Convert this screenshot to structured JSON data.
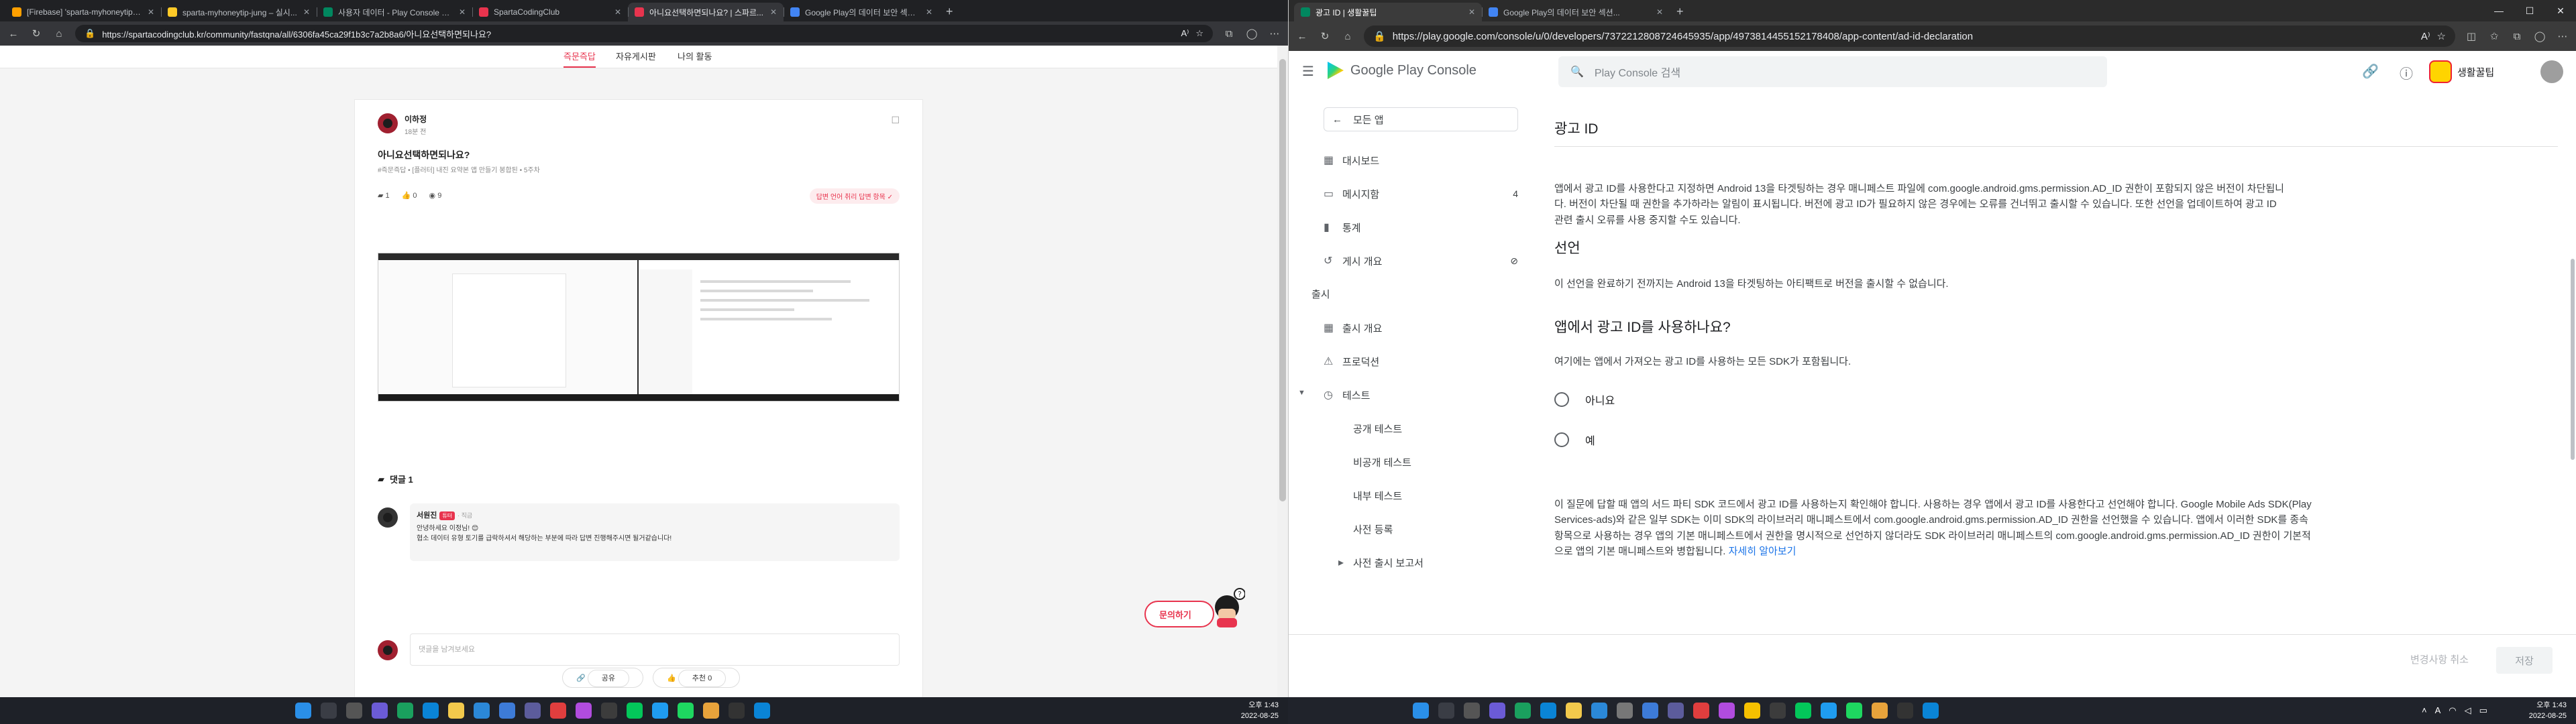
{
  "left_window": {
    "tabs": [
      {
        "label": "[Firebase] 'sparta-myhoneytip-j...",
        "fav_color": "#ffa000"
      },
      {
        "label": "sparta-myhoneytip-jung – 실시...",
        "fav_color": "#ffca28"
      },
      {
        "label": "사용자 데이터 - Play Console 고...",
        "fav_color": "#01875f"
      },
      {
        "label": "SpartaCodingClub",
        "fav_color": "#e8344e"
      },
      {
        "label": "아니요선택하면되나요? | 스파르...",
        "fav_color": "#e8344e",
        "active": true
      },
      {
        "label": "Google Play의 데이터 보안 섹션...",
        "fav_color": "#4285f4"
      }
    ],
    "url": "https://spartacodingclub.kr/community/fastqna/all/6306fa45ca29f1b3c7a2b8a6/아니요선택하면되나요?",
    "nav": {
      "active": "즉문즉답",
      "items": [
        "즉문즉답",
        "자유게시판",
        "나의 활동"
      ]
    },
    "post": {
      "author": "이하정",
      "time": "18분 전",
      "title": "아니요선택하면되나요?",
      "tags": "#즉문즉답 • [플러터] 내진 요약본 앱 만들기 봉합된 • 5주차",
      "likes_comments": "1",
      "likes": "0",
      "views": "9",
      "answer_label": "답변 언어 취리 답변 항목"
    },
    "comments": {
      "heading": "댓글 1",
      "items": [
        {
          "name": "서원진",
          "badge": "튜터",
          "time": "·  직금",
          "text_1": "안녕하세요 이정님! 😊",
          "text_2": "협소 데이터 유형 토기를 급락하셔서 해당하는 부분에 따라 답변 진행해주시면 될거같습니다!"
        }
      ],
      "input_placeholder": "댓글을 남겨보세요"
    },
    "actions": {
      "share": "공유",
      "recommend": "추천 0"
    },
    "inquiry_label": "문의하기"
  },
  "right_window": {
    "tabs": [
      {
        "label": "광고 ID | 생활꿀팁",
        "active": true,
        "fav_color": "#01875f"
      },
      {
        "label": "Google Play의 데이터 보안 섹션...",
        "fav_color": "#4285f4"
      }
    ],
    "url": "https://play.google.com/console/u/0/developers/7372212808724645935/app/4973814455152178408/app-content/ad-id-declaration",
    "brand": "Google Play Console",
    "search_placeholder": "Play Console 검색",
    "app_name": "생활꿀팁",
    "nav": {
      "all_apps": "모든 앱",
      "items": [
        {
          "label": "대시보드",
          "icon": "dashboard-icon"
        },
        {
          "label": "메시지함",
          "icon": "inbox-icon",
          "count": "4"
        },
        {
          "label": "통계",
          "icon": "chart-icon"
        },
        {
          "label": "게시 개요",
          "icon": "publish-icon"
        }
      ],
      "section": "출시",
      "release_items": [
        {
          "label": "출시 개요"
        },
        {
          "label": "프로덕션"
        },
        {
          "label": "테스트"
        }
      ],
      "test_items": [
        "공개 테스트",
        "비공개 테스트",
        "내부 테스트",
        "사전 등록"
      ],
      "reports": "사전 출시 보고서"
    },
    "content": {
      "title": "광고 ID",
      "intro": "앱에서 광고 ID를 사용한다고 지정하면 Android 13을 타겟팅하는 경우 매니페스트 파일에 com.google.android.gms.permission.AD_ID 권한이 포함되지 않은 버전이 차단됩니다. 버전이 차단될 때 권한을 추가하라는 알림이 표시됩니다. 버전에 광고 ID가 필요하지 않은 경우에는 오류를 건너뛰고 출시할 수 있습니다. 또한 선언을 업데이트하여 광고 ID 관련 출시 오류를 사용 중지할 수도 있습니다.",
      "declaration_heading": "선언",
      "declaration_text": "이 선언을 완료하기 전까지는 Android 13을 타겟팅하는 아티팩트로 버전을 출시할 수 없습니다.",
      "question": "앱에서 광고 ID를 사용하나요?",
      "question_hint": "여기에는 앱에서 가져오는 광고 ID를 사용하는 모든 SDK가 포함됩니다.",
      "option_no": "아니요",
      "option_yes": "예",
      "help": "이 질문에 답할 때 앱의 서드 파티 SDK 코드에서 광고 ID를 사용하는지 확인해야 합니다. 사용하는 경우 앱에서 광고 ID를 사용한다고 선언해야 합니다. Google Mobile Ads SDK(Play Services-ads)와 같은 일부 SDK는 이미 SDK의 라이브러리 매니페스트에서 com.google.android.gms.permission.AD_ID 권한을 선언했을 수 있습니다. 앱에서 이러한 SDK를 종속 항목으로 사용하는 경우 앱의 기본 매니페스트에서 권한을 명시적으로 선언하지 않더라도 SDK 라이브러리 매니페스트의 com.google.android.gms.permission.AD_ID 권한이 기본적으로 앱의 기본 매니페스트와 병합됩니다.",
      "learn_more": "자세히 알아보기"
    },
    "footer": {
      "discard": "변경사항 취소",
      "save": "저장"
    }
  },
  "clock_left": {
    "time": "오후 1:43",
    "date": "2022-08-25"
  },
  "clock_right": {
    "time": "오후 1:43",
    "date": "2022-08-25"
  }
}
